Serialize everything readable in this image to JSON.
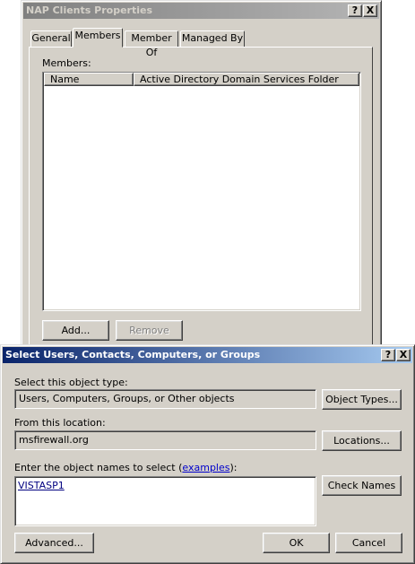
{
  "props": {
    "title": "NAP Clients Properties",
    "help_button": "?",
    "close_button": "X",
    "tabs": [
      {
        "label": "General"
      },
      {
        "label": "Members"
      },
      {
        "label": "Member Of"
      },
      {
        "label": "Managed By"
      }
    ],
    "members_label": "Members:",
    "columns": [
      "Name",
      "Active Directory Domain Services Folder"
    ],
    "add_button": "Add...",
    "remove_button": "Remove"
  },
  "select": {
    "title": "Select Users, Contacts, Computers, or Groups",
    "help_button": "?",
    "close_button": "X",
    "object_type_label": "Select this object type:",
    "object_type_value": "Users, Computers, Groups, or Other objects",
    "object_types_button": "Object Types...",
    "location_label": "From this location:",
    "location_value": "msfirewall.org",
    "locations_button": "Locations...",
    "names_label_prefix": "Enter the object names to select (",
    "names_label_link": "examples",
    "names_label_suffix": "):",
    "names_value": "VISTASP1",
    "check_names_button": "Check Names",
    "advanced_button": "Advanced...",
    "ok_button": "OK",
    "cancel_button": "Cancel"
  },
  "colors": {
    "face": "#d4d0c8",
    "active_title": "#0a246a",
    "inactive_title": "#808080",
    "link": "#0000cc"
  }
}
